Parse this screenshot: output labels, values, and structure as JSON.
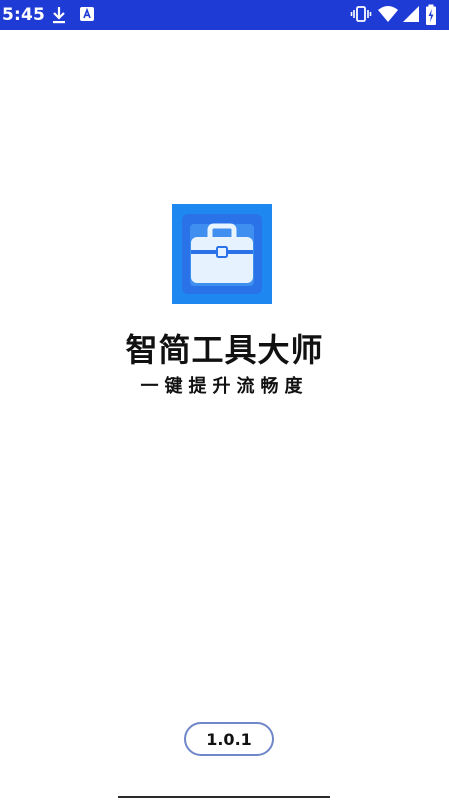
{
  "status_bar": {
    "time": "5:45",
    "background_color": "#1f3bd6",
    "left_icons": [
      "download-icon",
      "a-badge-icon"
    ],
    "right_icons": [
      "vibrate-icon",
      "wifi-icon",
      "cell-signal-icon",
      "battery-charging-icon"
    ]
  },
  "splash": {
    "app_name": "智简工具大师",
    "slogan": "一键提升流畅度",
    "icon": "toolbox-icon",
    "icon_color": "#1e88f0"
  },
  "footer": {
    "version": "1.0.1",
    "pill_border_color": "#6f86c9"
  }
}
